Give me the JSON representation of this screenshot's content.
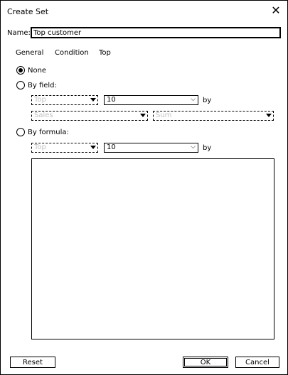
{
  "dialog": {
    "title": "Create Set",
    "close_symbol": "✕"
  },
  "name": {
    "label": "Name:",
    "value": "Top customer"
  },
  "tabs": [
    {
      "label": "General"
    },
    {
      "label": "Condition"
    },
    {
      "label": "Top"
    }
  ],
  "options": {
    "none_label": "None",
    "by_field_label": "By field:",
    "by_formula_label": "By formula:",
    "selected": "None"
  },
  "by_field": {
    "direction_value": "Top",
    "count_value": "10",
    "by_label": "by",
    "field_value": "Sales",
    "aggregation_value": "Sum"
  },
  "by_formula": {
    "direction_value": "Top",
    "count_value": "10",
    "by_label": "by",
    "formula_text": ""
  },
  "buttons": {
    "reset": "Reset",
    "ok": "OK",
    "cancel": "Cancel"
  }
}
